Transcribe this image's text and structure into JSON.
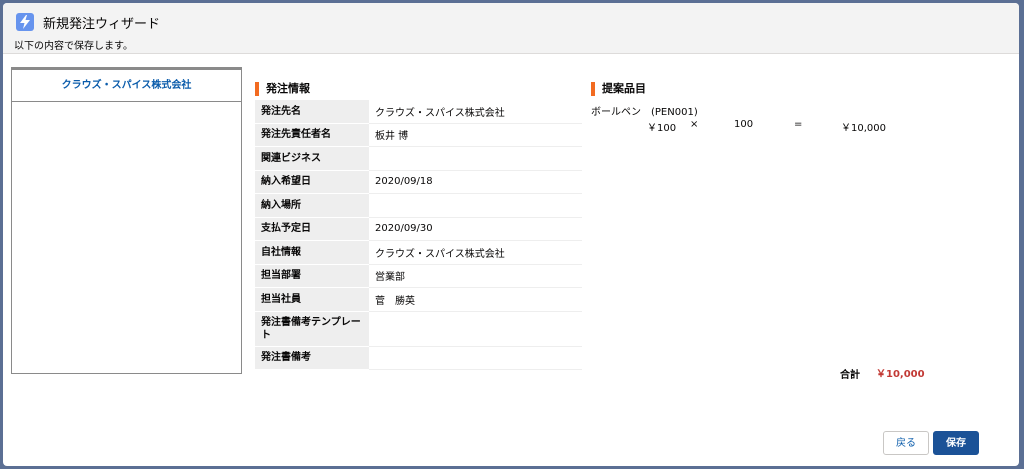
{
  "header": {
    "title": "新規発注ウィザード",
    "subtitle": "以下の内容で保存します。",
    "icon": "lightning-icon",
    "icon_color": "#6794ee"
  },
  "left_panel": {
    "tab_label": "クラウズ・スパイス株式会社"
  },
  "order_info": {
    "section_title": "発注情報",
    "rows": [
      {
        "label": "発注先名",
        "value": "クラウズ・スパイス株式会社"
      },
      {
        "label": "発注先責任者名",
        "value": "板井 博"
      },
      {
        "label": "関連ビジネス",
        "value": ""
      },
      {
        "label": "納入希望日",
        "value": "2020/09/18"
      },
      {
        "label": "納入場所",
        "value": ""
      },
      {
        "label": "支払予定日",
        "value": "2020/09/30"
      },
      {
        "label": "自社情報",
        "value": "クラウズ・スパイス株式会社"
      },
      {
        "label": "担当部署",
        "value": "営業部"
      },
      {
        "label": "担当社員",
        "value": "菅　勝英"
      },
      {
        "label": "発注書備考テンプレート",
        "value": ""
      },
      {
        "label": "発注書備考",
        "value": ""
      }
    ]
  },
  "items": {
    "section_title": "提案品目",
    "lines": [
      {
        "name": "ボールペン　(PEN001)",
        "price": "￥100",
        "times": "×",
        "qty": "100",
        "equals": "=",
        "amount": "￥10,000"
      }
    ],
    "total_label": "合計",
    "total_value": "￥10,000",
    "total_color": "#c23934"
  },
  "footer": {
    "back_label": "戻る",
    "save_label": "保存"
  },
  "colors": {
    "accent": "#f26b21",
    "primary": "#1b5297",
    "link": "#0b5cab"
  }
}
